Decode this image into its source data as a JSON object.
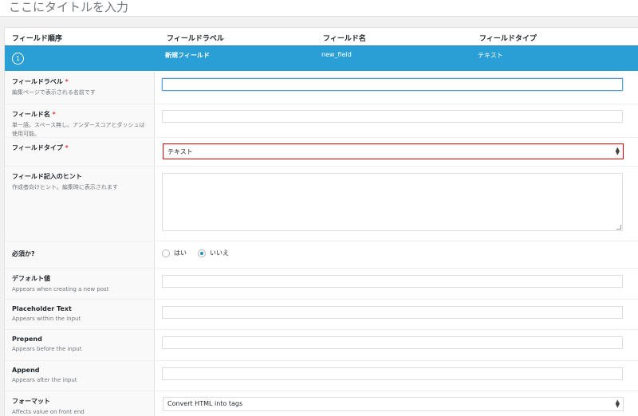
{
  "page": {
    "title": "ここにタイトルを入力"
  },
  "columns": {
    "order": "フィールド順序",
    "label": "フィールドラベル",
    "name": "フィールド名",
    "type": "フィールドタイプ"
  },
  "field": {
    "order": "1",
    "label": "新規フィールド",
    "name": "new_field",
    "type": "テキスト"
  },
  "form": {
    "label": {
      "title": "フィールドラベル",
      "required": "*",
      "desc": "編集ページで表示される名前です",
      "value": ""
    },
    "name": {
      "title": "フィールド名",
      "required": "*",
      "desc": "単一語。スペース無し。アンダースコアとダッシュは使用可能。",
      "value": ""
    },
    "type": {
      "title": "フィールドタイプ",
      "required": "*",
      "value": "テキスト"
    },
    "hint": {
      "title": "フィールド記入のヒント",
      "desc": "作成者向けヒント。編集時に表示されます",
      "value": ""
    },
    "required": {
      "title": "必須か?",
      "yes": "はい",
      "no": "いいえ",
      "selected": "no"
    },
    "default": {
      "title": "デフォルト値",
      "desc": "Appears when creating a new post",
      "value": ""
    },
    "placeholder": {
      "title": "Placeholder Text",
      "desc": "Appears within the input",
      "value": ""
    },
    "prepend": {
      "title": "Prepend",
      "desc": "Appears before the input",
      "value": ""
    },
    "append": {
      "title": "Append",
      "desc": "Appears after the input",
      "value": ""
    },
    "format": {
      "title": "フォーマット",
      "desc": "Affects value on front end",
      "value": "Convert HTML into tags"
    }
  },
  "colors": {
    "accent": "#2a9fd6",
    "required": "#dd3d36",
    "error": "#dd0000"
  }
}
